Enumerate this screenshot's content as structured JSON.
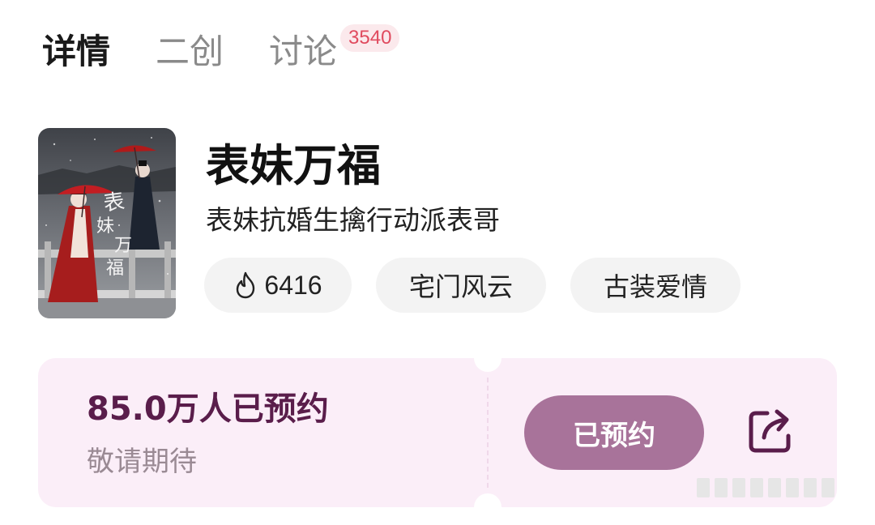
{
  "tabs": [
    {
      "label": "详情",
      "active": true
    },
    {
      "label": "二创",
      "active": false
    },
    {
      "label": "讨论",
      "active": false,
      "badge": "3540"
    }
  ],
  "show": {
    "title": "表妹万福",
    "subtitle": "表妹抗婚生擒行动派表哥",
    "poster_text": "表妹万福",
    "heat": "6416",
    "heat_icon": "flame-icon",
    "categories": [
      "宅门风云",
      "古装爱情"
    ]
  },
  "reservation": {
    "count_text": "85.0万人已预约",
    "hint": "敬请期待",
    "button_label": "已预约",
    "share_icon": "share-icon"
  },
  "colors": {
    "accent": "#a8739a",
    "count_text": "#5a1d4b",
    "card_bg": "#fbeef8",
    "badge_text": "#e04b5f",
    "badge_bg": "#fbe9ec"
  }
}
